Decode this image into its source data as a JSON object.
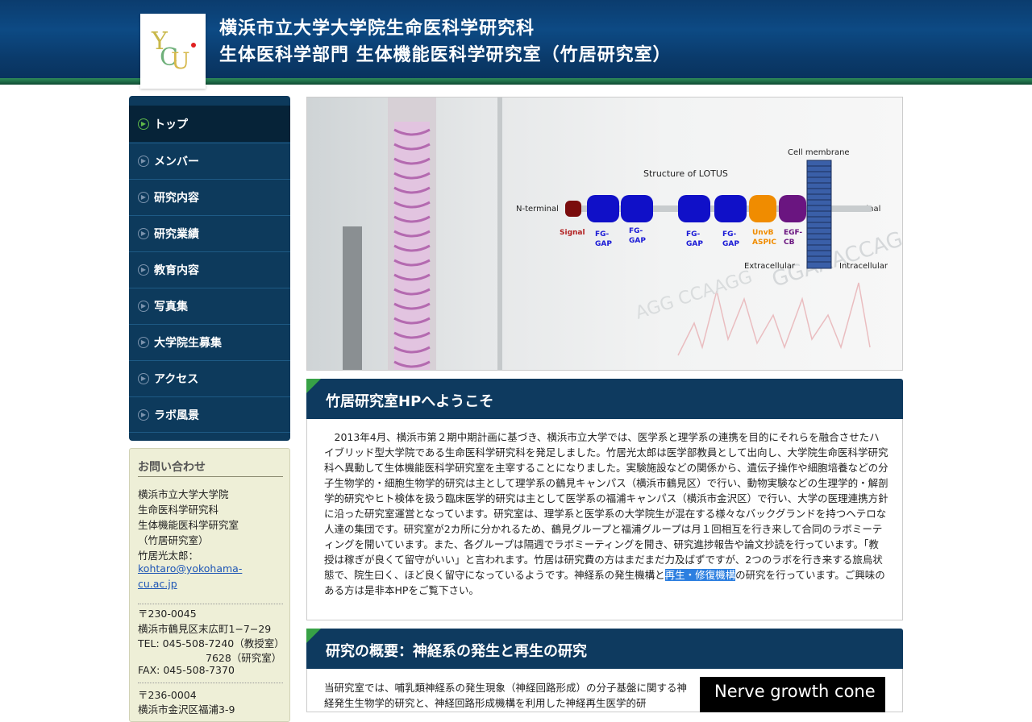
{
  "header": {
    "title_line1": "横浜市立大学大学院生命医科学研究科",
    "title_line2": "生体医科学部門 生体機能医科学研究室（竹居研究室）",
    "logo_text": "YCU"
  },
  "nav": {
    "items": [
      {
        "label": "トップ",
        "active": true
      },
      {
        "label": "メンバー"
      },
      {
        "label": "研究内容"
      },
      {
        "label": "研究業績"
      },
      {
        "label": "教育内容"
      },
      {
        "label": "写真集"
      },
      {
        "label": "大学院生募集"
      },
      {
        "label": "アクセス"
      },
      {
        "label": "ラボ風景"
      }
    ]
  },
  "contact": {
    "title": "お問い合わせ",
    "lines": [
      "横浜市立大学大学院",
      "生命医科学研究科",
      "生体機能医科学研究室",
      "（竹居研究室）",
      "竹居光太郎："
    ],
    "email_1": "kohtaro@yokohama-",
    "email_2": "cu.ac.jp",
    "address1": [
      "〒230-0045",
      "横浜市鶴見区末広町1−7−29",
      "TEL: 045-508-7240（教授室）",
      "7628（研究室）",
      "FAX: 045-508-7370"
    ],
    "address2": [
      "〒236-0004",
      "横浜市金沢区福浦3-9"
    ]
  },
  "hero": {
    "structure_title": "Structure of LOTUS",
    "cell_membrane": "Cell membrane",
    "n_terminal": "N-terminal",
    "c_terminal": "C-terminal",
    "extracellular": "Extracellular",
    "intracellular": "Intracellular",
    "domains": [
      {
        "label": "Signal",
        "color": "#b22222"
      },
      {
        "label": "FG-\nGAP",
        "color": "#1a1ad6"
      },
      {
        "label": "FG-\nGAP",
        "color": "#1a1ad6"
      },
      {
        "label": "FG-\nGAP",
        "color": "#1a1ad6"
      },
      {
        "label": "FG-\nGAP",
        "color": "#1a1ad6"
      },
      {
        "label": "UnvB\nASPIC",
        "color": "#f08c00"
      },
      {
        "label": "EGF-\nCB",
        "color": "#7a1f90"
      }
    ]
  },
  "welcome": {
    "title": "竹居研究室HPへようこそ",
    "body_before": "　2013年4月、横浜市第２期中期計画に基づき、横浜市立大学では、医学系と理学系の連携を目的にそれらを融合させたハイブリッド型大学院である生命医科学研究科を発足しました。竹居光太郎は医学部教員として出向し、大学院生命医科学研究科へ異動して生体機能医科学研究室を主宰することになりました。実験施設などの関係から、遺伝子操作や細胞培養などの分子生物学的・細胞生物学的研究は主として理学系の鶴見キャンパス（横浜市鶴見区）で行い、動物実験などの生理学的・解剖学的研究やヒト検体を扱う臨床医学的研究は主として医学系の福浦キャンパス（横浜市金沢区）で行い、大学の医理連携方針に沿った研究室運営となっています。研究室は、理学系と医学系の大学院生が混在する様々なバックグランドを持つヘテロな人達の集団です。研究室が2カ所に分かれるため、鶴見グループと福浦グループは月１回相互を行き来して合同のラボミーティングを開いています。また、各グループは隔週でラボミーティングを開き、研究進捗報告や論文抄読を行っています。「教授は稼ぎが良くて留守がいい」と言われます。竹居は研究費の方はまだまだ力及ばずですが、2つのラボを行き来する旅烏状態で、院生曰く、ほど良く留守になっているようです。神経系の発生機構と",
    "body_highlight": "再生・修復機構",
    "body_after": "の研究を行っています。ご興味のある方は是非本HPをご覧下さい。"
  },
  "research": {
    "title": "研究の概要：神経系の発生と再生の研究",
    "body": "当研究室では、哺乳類神経系の発生現象（神経回路形成）の分子基盤に関する神経発生生物学的研究と、神経回路形成機構を利用した神経再生医学的研",
    "image_caption": "Nerve growth cone"
  }
}
